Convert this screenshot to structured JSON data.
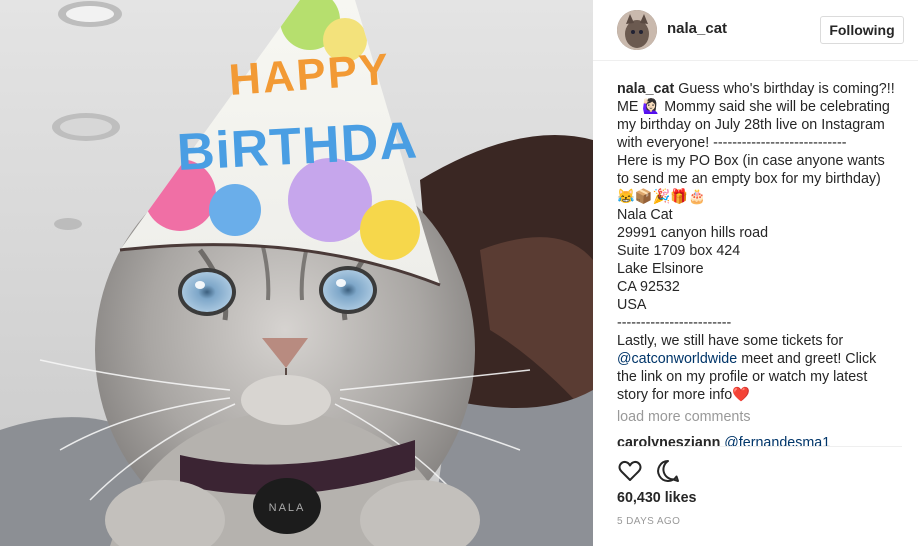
{
  "post": {
    "username": "nala_cat",
    "follow_button": "Following",
    "photo_hat_text": "HAPPY BIRTHDAY",
    "tag_text": "NALA"
  },
  "caption": {
    "user": "nala_cat",
    "lines": [
      "Guess who's birthday is coming?!!",
      "ME 🙋🏻‍♀️ Mommy said she will be celebrating",
      "my birthday on July 28th live on Instagram",
      "with everyone! ----------------------------",
      "Here is my PO Box (in case anyone wants",
      "to send me an empty box for my birthday)",
      "😹📦🎉🎁🎂",
      "Nala Cat",
      "29991 canyon hills road",
      "Suite 1709 box 424",
      "Lake Elsinore",
      "CA 92532",
      "USA",
      "------------------------",
      "Lastly, we still have some tickets for"
    ],
    "mention": "@catconworldwide",
    "mention_rest": " meet and greet! Click",
    "tail_lines": [
      "the link on my profile or watch my latest",
      "story for more info❤️"
    ]
  },
  "load_more": "load more comments",
  "partial_comment": {
    "user": "carolynesziann",
    "text": "@fernandesma1"
  },
  "actions": {
    "like_icon": "heart-icon",
    "comment_icon": "comment-icon"
  },
  "likes": "60,430 likes",
  "timestamp": "5 DAYS AGO",
  "colors": {
    "link": "#003569",
    "muted": "#999999",
    "border": "#dbdbdb"
  }
}
